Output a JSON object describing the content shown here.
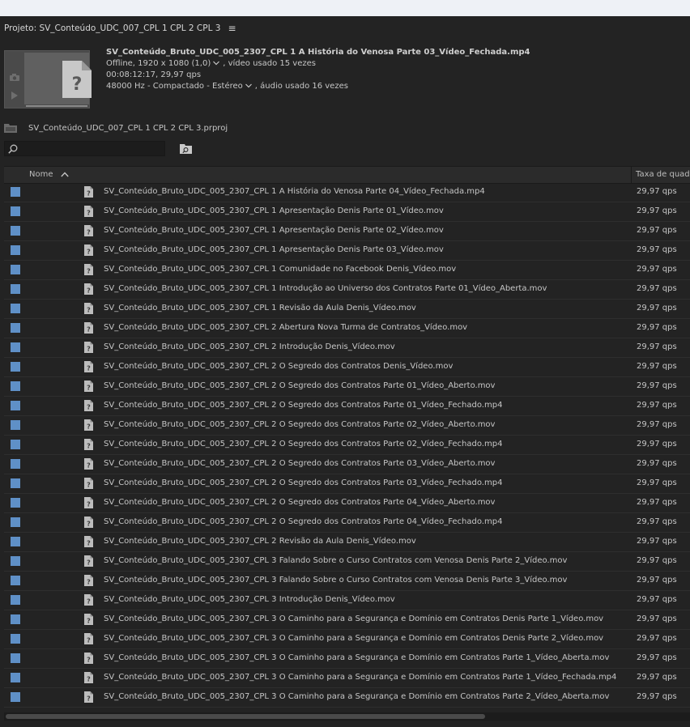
{
  "panel": {
    "title": "Projeto: SV_Conteúdo_UDC_007_CPL 1 CPL 2 CPL 3",
    "menu_icon": "hamburger-menu-icon"
  },
  "clip_preview": {
    "name": "SV_Conteúdo_Bruto_UDC_005_2307_CPL 1 A História do Venosa Parte 03_Vídeo_Fechada.mp4",
    "video_line_a": "Offline, 1920 x 1080 (1,0)",
    "video_line_b": ", vídeo usado 15 vezes",
    "duration": "00:08:12:17, 29,97 qps",
    "audio_line_a": "48000 Hz - Compactado - Estéreo",
    "audio_line_b": ", áudio usado 16 vezes"
  },
  "project": {
    "file": "SV_Conteúdo_UDC_007_CPL 1 CPL 2 CPL 3.prproj"
  },
  "search": {
    "value": "",
    "placeholder": ""
  },
  "list": {
    "col_name": "Nome",
    "col_framerate": "Taxa de quad",
    "rows": [
      {
        "name": "SV_Conteúdo_Bruto_UDC_005_2307_CPL 1 A História do Venosa Parte 04_Vídeo_Fechada.mp4",
        "fps": "29,97 qps"
      },
      {
        "name": "SV_Conteúdo_Bruto_UDC_005_2307_CPL 1 Apresentação Denis Parte 01_Vídeo.mov",
        "fps": "29,97 qps"
      },
      {
        "name": "SV_Conteúdo_Bruto_UDC_005_2307_CPL 1 Apresentação Denis Parte 02_Vídeo.mov",
        "fps": "29,97 qps"
      },
      {
        "name": "SV_Conteúdo_Bruto_UDC_005_2307_CPL 1 Apresentação Denis Parte 03_Vídeo.mov",
        "fps": "29,97 qps"
      },
      {
        "name": "SV_Conteúdo_Bruto_UDC_005_2307_CPL 1 Comunidade no Facebook Denis_Vídeo.mov",
        "fps": "29,97 qps"
      },
      {
        "name": "SV_Conteúdo_Bruto_UDC_005_2307_CPL 1 Introdução ao Universo dos Contratos Parte 01_Vídeo_Aberta.mov",
        "fps": "29,97 qps"
      },
      {
        "name": "SV_Conteúdo_Bruto_UDC_005_2307_CPL 1 Revisão da Aula Denis_Vídeo.mov",
        "fps": "29,97 qps"
      },
      {
        "name": "SV_Conteúdo_Bruto_UDC_005_2307_CPL 2 Abertura Nova Turma de Contratos_Vídeo.mov",
        "fps": "29,97 qps"
      },
      {
        "name": "SV_Conteúdo_Bruto_UDC_005_2307_CPL 2 Introdução Denis_Vídeo.mov",
        "fps": "29,97 qps"
      },
      {
        "name": "SV_Conteúdo_Bruto_UDC_005_2307_CPL 2 O Segredo dos Contratos Denis_Vídeo.mov",
        "fps": "29,97 qps"
      },
      {
        "name": "SV_Conteúdo_Bruto_UDC_005_2307_CPL 2 O Segredo dos Contratos Parte 01_Vídeo_Aberto.mov",
        "fps": "29,97 qps"
      },
      {
        "name": "SV_Conteúdo_Bruto_UDC_005_2307_CPL 2 O Segredo dos Contratos Parte 01_Vídeo_Fechado.mp4",
        "fps": "29,97 qps"
      },
      {
        "name": "SV_Conteúdo_Bruto_UDC_005_2307_CPL 2 O Segredo dos Contratos Parte 02_Vídeo_Aberto.mov",
        "fps": "29,97 qps"
      },
      {
        "name": "SV_Conteúdo_Bruto_UDC_005_2307_CPL 2 O Segredo dos Contratos Parte 02_Vídeo_Fechado.mp4",
        "fps": "29,97 qps"
      },
      {
        "name": "SV_Conteúdo_Bruto_UDC_005_2307_CPL 2 O Segredo dos Contratos Parte 03_Vídeo_Aberto.mov",
        "fps": "29,97 qps"
      },
      {
        "name": "SV_Conteúdo_Bruto_UDC_005_2307_CPL 2 O Segredo dos Contratos Parte 03_Vídeo_Fechado.mp4",
        "fps": "29,97 qps"
      },
      {
        "name": "SV_Conteúdo_Bruto_UDC_005_2307_CPL 2 O Segredo dos Contratos Parte 04_Vídeo_Aberto.mov",
        "fps": "29,97 qps"
      },
      {
        "name": "SV_Conteúdo_Bruto_UDC_005_2307_CPL 2 O Segredo dos Contratos Parte 04_Vídeo_Fechado.mp4",
        "fps": "29,97 qps"
      },
      {
        "name": "SV_Conteúdo_Bruto_UDC_005_2307_CPL 2 Revisão da Aula Denis_Vídeo.mov",
        "fps": "29,97 qps"
      },
      {
        "name": "SV_Conteúdo_Bruto_UDC_005_2307_CPL 3 Falando Sobre o Curso Contratos com Venosa Denis Parte 2_Vídeo.mov",
        "fps": "29,97 qps"
      },
      {
        "name": "SV_Conteúdo_Bruto_UDC_005_2307_CPL 3 Falando Sobre o Curso Contratos com Venosa Denis Parte 3_Vídeo.mov",
        "fps": "29,97 qps"
      },
      {
        "name": "SV_Conteúdo_Bruto_UDC_005_2307_CPL 3 Introdução Denis_Vídeo.mov",
        "fps": "29,97 qps"
      },
      {
        "name": "SV_Conteúdo_Bruto_UDC_005_2307_CPL 3 O Caminho para a Segurança e Domínio em Contratos Denis Parte 1_Vídeo.mov",
        "fps": "29,97 qps"
      },
      {
        "name": "SV_Conteúdo_Bruto_UDC_005_2307_CPL 3 O Caminho para a Segurança e Domínio em Contratos Denis Parte 2_Vídeo.mov",
        "fps": "29,97 qps"
      },
      {
        "name": "SV_Conteúdo_Bruto_UDC_005_2307_CPL 3 O Caminho para a Segurança e Domínio em Contratos Parte 1_Vídeo_Aberta.mov",
        "fps": "29,97 qps"
      },
      {
        "name": "SV_Conteúdo_Bruto_UDC_005_2307_CPL 3 O Caminho para a Segurança e Domínio em Contratos Parte 1_Vídeo_Fechada.mp4",
        "fps": "29,97 qps"
      },
      {
        "name": "SV_Conteúdo_Bruto_UDC_005_2307_CPL 3 O Caminho para a Segurança e Domínio em Contratos Parte 2_Vídeo_Aberta.mov",
        "fps": "29,97 qps"
      }
    ]
  },
  "colors": {
    "panel_bg": "#232323",
    "label_color": "#5f90c7",
    "text": "#c6c6c6"
  }
}
